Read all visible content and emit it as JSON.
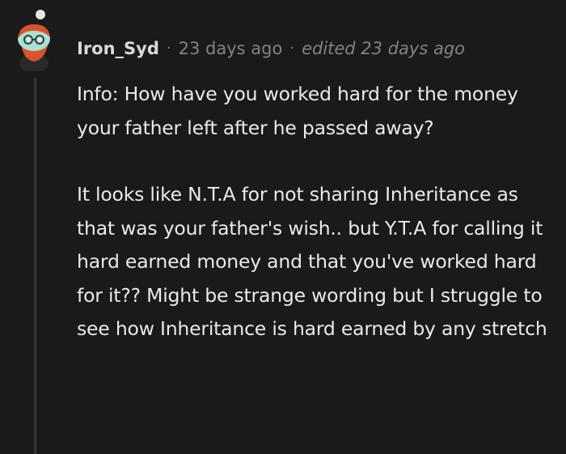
{
  "comment": {
    "username": "Iron_Syd",
    "posted": "23 days ago",
    "edited": "edited 23 days ago",
    "separator": "·",
    "paragraphs": [
      "Info: How have you worked hard for the money your father left after he passed away?",
      "It looks like N.T.A for not sharing Inheritance as that was your father's wish.. but Y.T.A for calling it hard earned money and that you've worked hard for it?? Might be strange wording but I struggle to see how Inheritance is hard earned by any stretch"
    ]
  },
  "icons": {
    "avatar": "snoo-avatar-icon"
  },
  "colors": {
    "background": "#1a1a1b",
    "text": "#d7dadc",
    "meta": "#818384",
    "thread_line": "#343536",
    "avatar_hair": "#d9532c",
    "avatar_skin": "#a9e1d4"
  }
}
